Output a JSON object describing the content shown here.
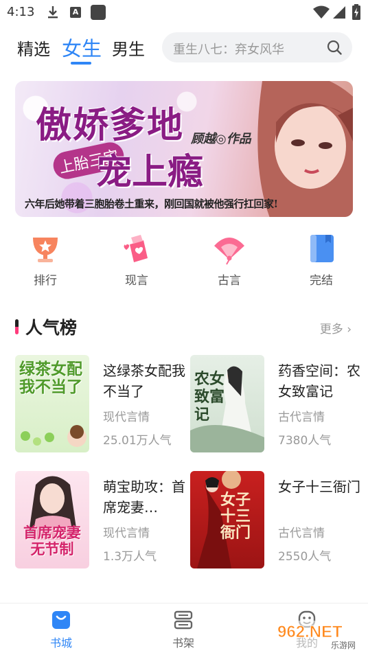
{
  "status_bar": {
    "time": "4:13",
    "icons": [
      "download-icon",
      "a-icon",
      "app-square-icon",
      "wifi-icon",
      "signal-icon",
      "battery-icon"
    ],
    "a_glyph": "A"
  },
  "top_nav": {
    "tabs": [
      {
        "label": "精选",
        "active": false
      },
      {
        "label": "女生",
        "active": true
      },
      {
        "label": "男生",
        "active": false
      }
    ],
    "search_placeholder": "重生八七：弃女风华"
  },
  "banner": {
    "title_line1": "傲娇爹地",
    "title_line2": "宠上瘾",
    "tag": "上胎三宝",
    "author": "顾越◎作品",
    "tagline": "六年后她带着三胞胎卷土重来，刚回国就被他强行扛回家!"
  },
  "categories": [
    {
      "label": "排行",
      "icon": "trophy-icon"
    },
    {
      "label": "现言",
      "icon": "heart-bag-icon"
    },
    {
      "label": "古言",
      "icon": "fan-icon"
    },
    {
      "label": "完结",
      "icon": "book-icon"
    }
  ],
  "section": {
    "title": "人气榜",
    "more": "更多",
    "more_arrow": "›"
  },
  "books": [
    {
      "title": "这绿茶女配我不当了",
      "genre": "现代言情",
      "popularity": "25.01万人气",
      "cover_text": "绿茶女配我不当了"
    },
    {
      "title": "药香空间：农女致富记",
      "genre": "古代言情",
      "popularity": "7380人气",
      "cover_text": "农女致富记"
    },
    {
      "title": "萌宝助攻：首席宠妻…",
      "genre": "现代言情",
      "popularity": "1.3万人气",
      "cover_text": "首席宠妻无节制"
    },
    {
      "title": "女子十三衙门",
      "genre": "古代言情",
      "popularity": "2550人气",
      "cover_text": "女子十三衙门"
    }
  ],
  "bottom_nav": [
    {
      "label": "书城",
      "active": true
    },
    {
      "label": "书架",
      "active": false
    },
    {
      "label": "我的",
      "active": false
    }
  ],
  "watermark": {
    "text": "962.NET",
    "subtext": "乐游网"
  },
  "colors": {
    "accent": "#2f86f6",
    "section_pink": "#ff3b7c"
  }
}
